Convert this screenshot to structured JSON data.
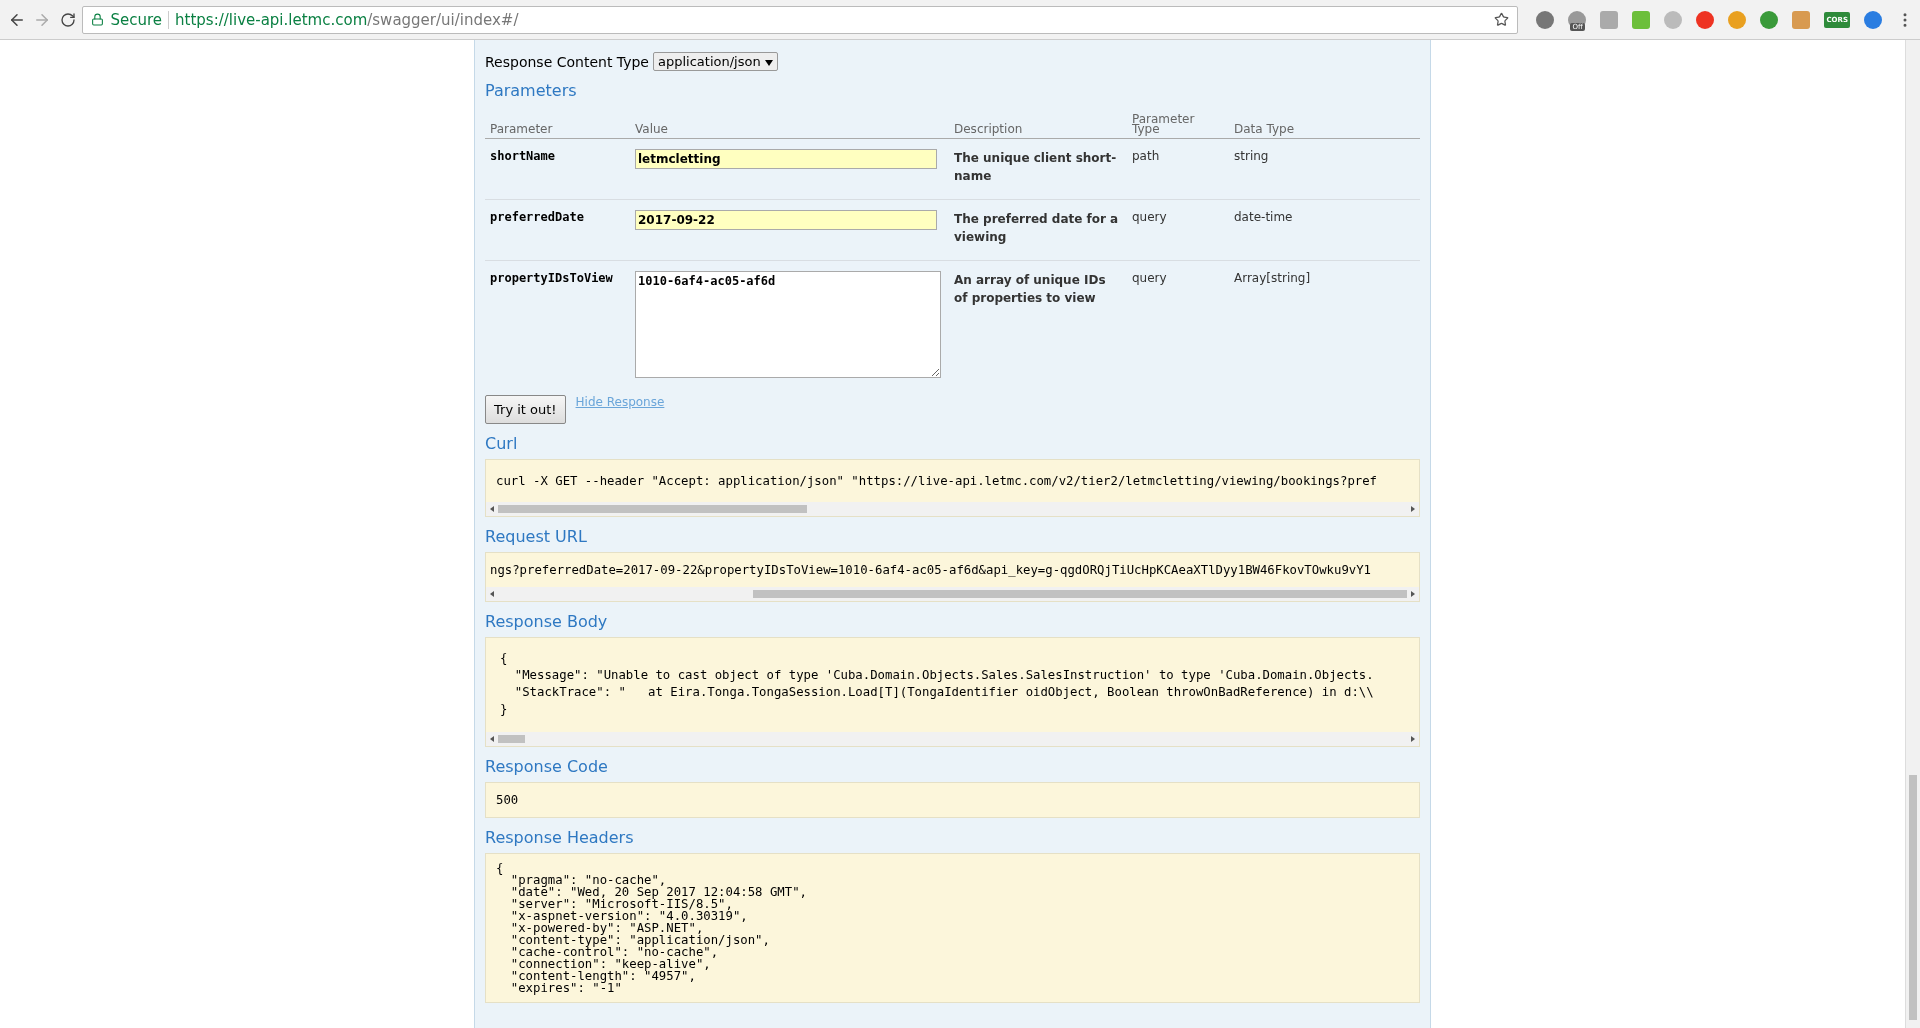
{
  "browser": {
    "secure_label": "Secure",
    "url_host": "https://live-api.letmc.com",
    "url_path": "/swagger/ui/index#/",
    "extension_badge": "Off",
    "extension_text": "CORS"
  },
  "response_content_type": {
    "label": "Response Content Type",
    "value": "application/json"
  },
  "parameters": {
    "title": "Parameters",
    "columns": [
      "Parameter",
      "Value",
      "Description",
      "Parameter Type",
      "Data Type"
    ],
    "rows": [
      {
        "name": "shortName",
        "kind": "input",
        "value": "letmcletting",
        "description": "The unique client short-name",
        "parameter_type": "path",
        "data_type": "string"
      },
      {
        "name": "preferredDate",
        "kind": "input",
        "value": "2017-09-22",
        "description": "The preferred date for a viewing",
        "parameter_type": "query",
        "data_type": "date-time"
      },
      {
        "name": "propertyIDsToView",
        "kind": "textarea",
        "value": "1010-6af4-ac05-af6d",
        "description": "An array of unique IDs of properties to view",
        "parameter_type": "query",
        "data_type": "Array[string]"
      }
    ]
  },
  "actions": {
    "button": "Try it out!",
    "link": "Hide Response"
  },
  "sections": [
    {
      "title": "Curl",
      "scrollable": true,
      "lines": [
        "curl -X GET --header \"Accept: application/json\" \"https://live-api.letmc.com/v2/tier2/letmcletting/viewing/bookings?pref"
      ]
    },
    {
      "title": "Request URL",
      "scrollable": true,
      "lines": [
        "ngs?preferredDate=2017-09-22&propertyIDsToView=1010-6af4-ac05-af6d&api_key=g-qgdORQjTiUcHpKCAeaXTlDyy1BW46FkovTOwku9vY1"
      ]
    },
    {
      "title": "Response Body",
      "scrollable": true,
      "lines": [
        "{",
        "  \"Message\": \"Unable to cast object of type 'Cuba.Domain.Objects.Sales.SalesInstruction' to type 'Cuba.Domain.Objects.",
        "  \"StackTrace\": \"   at Eira.Tonga.TongaSession.Load[T](TongaIdentifier oidObject, Boolean throwOnBadReference) in d:\\\\",
        "}"
      ]
    },
    {
      "title": "Response Code",
      "scrollable": false,
      "lines": [
        "500"
      ]
    },
    {
      "title": "Response Headers",
      "scrollable": false,
      "lines": [
        "{",
        "  \"pragma\": \"no-cache\",",
        "  \"date\": \"Wed, 20 Sep 2017 12:04:58 GMT\",",
        "  \"server\": \"Microsoft-IIS/8.5\",",
        "  \"x-aspnet-version\": \"4.0.30319\",",
        "  \"x-powered-by\": \"ASP.NET\",",
        "  \"content-type\": \"application/json\",",
        "  \"cache-control\": \"no-cache\",",
        "  \"connection\": \"keep-alive\",",
        "  \"content-length\": \"4957\",",
        "  \"expires\": \"-1\""
      ]
    }
  ]
}
